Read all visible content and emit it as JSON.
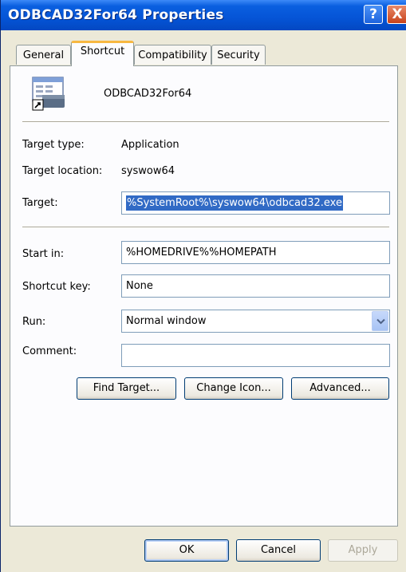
{
  "window": {
    "title": "ODBCAD32For64 Properties"
  },
  "titlebar": {
    "help_glyph": "?",
    "close_glyph": "X"
  },
  "tabs": [
    {
      "label": "General"
    },
    {
      "label": "Shortcut"
    },
    {
      "label": "Compatibility"
    },
    {
      "label": "Security"
    }
  ],
  "shortcut": {
    "app_name": "ODBCAD32For64",
    "target_type_label": "Target type:",
    "target_type_value": "Application",
    "target_location_label": "Target location:",
    "target_location_value": "syswow64",
    "target_label": "Target:",
    "target_value": "%SystemRoot%\\syswow64\\odbcad32.exe",
    "start_in_label": "Start in:",
    "start_in_value": "%HOMEDRIVE%%HOMEPATH",
    "shortcut_key_label": "Shortcut key:",
    "shortcut_key_value": "None",
    "run_label": "Run:",
    "run_value": "Normal window",
    "comment_label": "Comment:",
    "comment_value": "",
    "find_target_label": "Find Target...",
    "change_icon_label": "Change Icon...",
    "advanced_label": "Advanced..."
  },
  "footer": {
    "ok_label": "OK",
    "cancel_label": "Cancel",
    "apply_label": "Apply"
  }
}
